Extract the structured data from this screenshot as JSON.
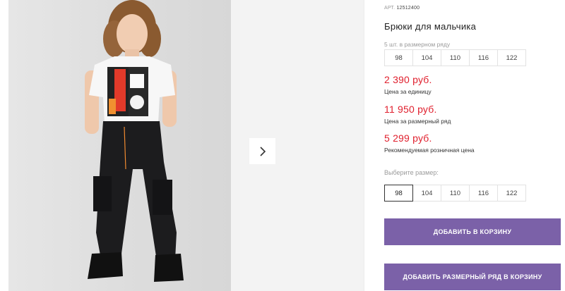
{
  "product": {
    "article_label": "АРТ.",
    "article": "12512400",
    "title": "Брюки для мальчика"
  },
  "pack": {
    "note": "5 шт. в размерном ряду",
    "sizes": [
      "98",
      "104",
      "110",
      "116",
      "122"
    ]
  },
  "prices": [
    {
      "value": "2 390 руб.",
      "label": "Цена за единицу"
    },
    {
      "value": "11 950 руб.",
      "label": "Цена за размерный ряд"
    },
    {
      "value": "5 299 руб.",
      "label": "Рекомендуемая розничная цена"
    }
  ],
  "size_select": {
    "label": "Выберите размер:",
    "sizes": [
      "98",
      "104",
      "110",
      "116",
      "122"
    ],
    "selected": "98"
  },
  "buttons": {
    "add_to_cart": "ДОБАВИТЬ В КОРЗИНУ",
    "add_size_row": "ДОБАВИТЬ РАЗМЕРНЫЙ РЯД В КОРЗИНУ"
  },
  "colors": {
    "price": "#e0202e",
    "button": "#7b61a8"
  },
  "icons": {
    "gallery_next": "chevron-right-icon"
  }
}
